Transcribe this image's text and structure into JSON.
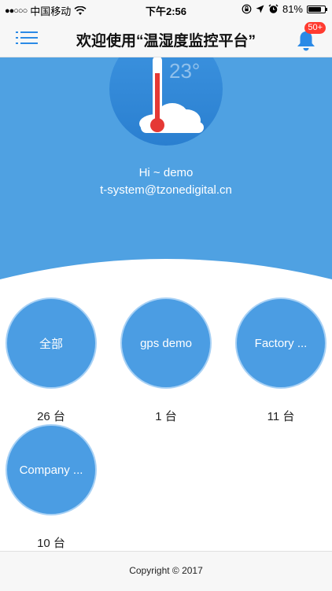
{
  "status_bar": {
    "signal": "●●○○○",
    "carrier": "中国移动",
    "time": "下午2:56",
    "battery": "81%",
    "battery_level": 0.81
  },
  "header": {
    "title": "欢迎使用“温湿度监控平台”",
    "badge": "50+"
  },
  "hero": {
    "temp_label": "23°",
    "greeting": "Hi ~ demo",
    "email": "t-system@tzonedigital.cn"
  },
  "devices": [
    {
      "label": "全部",
      "count": "26 台"
    },
    {
      "label": "gps demo",
      "count": "1 台"
    },
    {
      "label": "Factory ...",
      "count": "11 台"
    },
    {
      "label": "Company ...",
      "count": "10 台"
    }
  ],
  "footer": {
    "copyright": "Copyright © 2017"
  },
  "colors": {
    "accent": "#4fa1e2",
    "device_fill": "#4b9de3",
    "badge": "#ff3b30",
    "thermo_red": "#e53935"
  },
  "icons": {
    "menu": "menu-icon",
    "bell": "bell-icon",
    "wifi": "wifi-icon",
    "location": "location-arrow-icon",
    "alarm": "alarm-clock-icon",
    "rotation": "rotation-lock-icon"
  }
}
